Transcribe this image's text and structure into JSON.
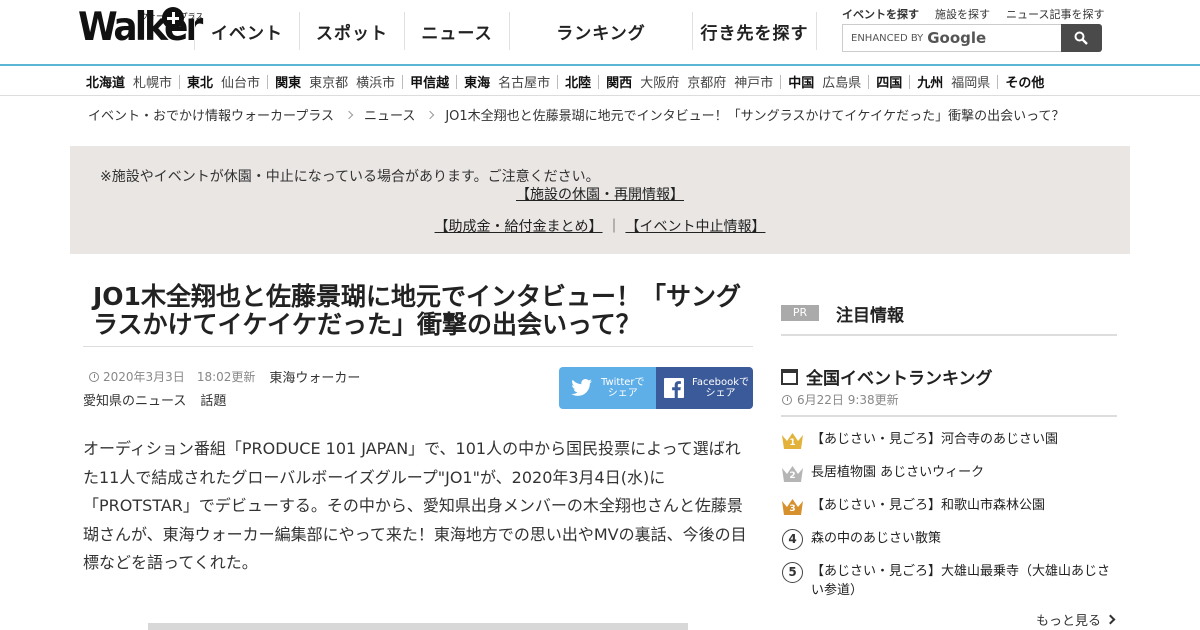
{
  "header": {
    "logo": {
      "text": "Walker",
      "sub": "ウォーカープラス"
    },
    "nav": [
      {
        "label": "イベント",
        "width": 105
      },
      {
        "label": "スポット",
        "width": 105
      },
      {
        "label": "ニュース",
        "width": 105
      },
      {
        "label": "ランキング",
        "width": 183
      },
      {
        "label": "行き先を探す",
        "width": 125
      }
    ],
    "top_links": [
      "イベントを探す",
      "施設を探す",
      "ニュース記事を探す"
    ],
    "search": {
      "enhanced": "ENHANCED BY",
      "google": "Google"
    }
  },
  "regions": [
    {
      "name": "北海道",
      "cities": [
        "札幌市"
      ]
    },
    {
      "name": "東北",
      "cities": [
        "仙台市"
      ]
    },
    {
      "name": "関東",
      "cities": [
        "東京都",
        "横浜市"
      ]
    },
    {
      "name": "甲信越",
      "cities": []
    },
    {
      "name": "東海",
      "cities": [
        "名古屋市"
      ]
    },
    {
      "name": "北陸",
      "cities": []
    },
    {
      "name": "関西",
      "cities": [
        "大阪府",
        "京都府",
        "神戸市"
      ]
    },
    {
      "name": "中国",
      "cities": [
        "広島県"
      ]
    },
    {
      "name": "四国",
      "cities": []
    },
    {
      "name": "九州",
      "cities": [
        "福岡県"
      ]
    },
    {
      "name": "その他",
      "cities": []
    }
  ],
  "breadcrumb": [
    "イベント・おでかけ情報ウォーカープラス",
    "ニュース",
    "JO1木全翔也と佐藤景瑚に地元でインタビュー！「サングラスかけてイケイケだった」衝撃の出会いって？"
  ],
  "notice": {
    "line1": "※施設やイベントが休園・中止になっている場合があります。ご注意ください。",
    "link1": "【施設の休園・再開情報】",
    "link2": "【助成金・給付金まとめ】",
    "divider": "｜",
    "link3": "【イベント中止情報】"
  },
  "article": {
    "title": "JO1木全翔也と佐藤景瑚に地元でインタビュー！「サングラスかけてイケイケだった」衝撃の出会いって？",
    "date": "2020年3月3日",
    "updated": "18:02更新",
    "source": "東海ウォーカー",
    "tags": [
      "愛知県のニュース",
      "話題"
    ],
    "share_twitter": [
      "Twitterで",
      "シェア"
    ],
    "share_facebook": [
      "Facebookで",
      "シェア"
    ],
    "lead": "オーディション番組「PRODUCE 101 JAPAN」で、101人の中から国民投票によって選ばれた11人で結成されたグローバルボーイズグループ\"JO1\"が、2020年3月4日(水)に「PROTSTAR」でデビューする。その中から、愛知県出身メンバーの木全翔也さんと佐藤景瑚さんが、東海ウォーカー編集部にやって来た！東海地方での思い出やMVの裏話、今後の目標などを語ってくれた。"
  },
  "sidebar": {
    "pr_badge": "PR",
    "pr_title": "注目情報",
    "ranking_title": "全国イベントランキング",
    "ranking_date": "6月22日 9:38更新",
    "ranking": [
      {
        "rank": "1",
        "label": "【あじさい・見ごろ】河合寺のあじさい園",
        "color": "#e2b23a"
      },
      {
        "rank": "2",
        "label": "長居植物園 あじさいウィーク",
        "color": "#b5b5b5"
      },
      {
        "rank": "3",
        "label": "【あじさい・見ごろ】和歌山市森林公園",
        "color": "#d6902e"
      },
      {
        "rank": "4",
        "label": "森の中のあじさい散策"
      },
      {
        "rank": "5",
        "label": "【あじさい・見ごろ】大雄山最乗寺（大雄山あじさい参道）"
      }
    ],
    "more": "もっと見る"
  },
  "colors": {
    "accent_line": "#5bb6d6",
    "twitter": "#5eaee8",
    "facebook": "#3b5a9a",
    "notice_bg": "#e9e6e4"
  }
}
